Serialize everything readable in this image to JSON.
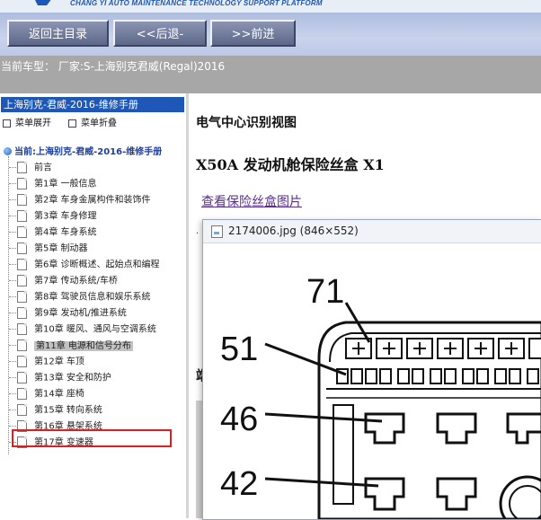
{
  "banner": {
    "tagline": "CHANG YI AUTO MAINTENANCE TECHNOLOGY SUPPORT PLATFORM"
  },
  "toolbar": {
    "home_label": "返回主目录",
    "back_label": "<<后退-",
    "forward_label": ">>前进"
  },
  "vehicle": {
    "text": "当前车型：  厂家:S-上海别克君威(Regal)2016"
  },
  "sidebar": {
    "title": "上海别克-君威-2016-维修手册",
    "expand_label": "菜单展开",
    "collapse_label": "菜单折叠",
    "root_label": "当前:上海别克-君威-2016-维修手册",
    "items": [
      {
        "label": "前言"
      },
      {
        "label": "第1章 一般信息"
      },
      {
        "label": "第2章 车身金属构件和装饰件"
      },
      {
        "label": "第3章 车身修理"
      },
      {
        "label": "第4章 车身系统"
      },
      {
        "label": "第5章 制动器"
      },
      {
        "label": "第6章 诊断概述、起始点和编程"
      },
      {
        "label": "第7章 传动系统/车桥"
      },
      {
        "label": "第8章 驾驶员信息和娱乐系统"
      },
      {
        "label": "第9章 发动机/推进系统"
      },
      {
        "label": "第10章 暖风、通风与空调系统"
      },
      {
        "label": "第11章 电源和信号分布"
      },
      {
        "label": "第12章 车顶"
      },
      {
        "label": "第13章 安全和防护"
      },
      {
        "label": "第14章 座椅"
      },
      {
        "label": "第15章 转向系统"
      },
      {
        "label": "第16章 悬架系统"
      },
      {
        "label": "第17章 变速器"
      }
    ],
    "selected_index": 11
  },
  "main": {
    "title": "电气中心识别视图",
    "heading": "X50A 发动机舱保险丝盒 X1",
    "link_label": "查看保险丝盒图片",
    "partial_char": "端"
  },
  "viewer": {
    "title": "2174006.jpg (846×552)",
    "callouts": [
      "71",
      "51",
      "46",
      "42"
    ]
  },
  "colors": {
    "sidebar_title_bg": "#1e57b5",
    "toolbar_button": "#5d6889",
    "vehicle_bar": "#a7a7a7",
    "highlight": "#e31c1c",
    "link": "#5a2d8e"
  }
}
